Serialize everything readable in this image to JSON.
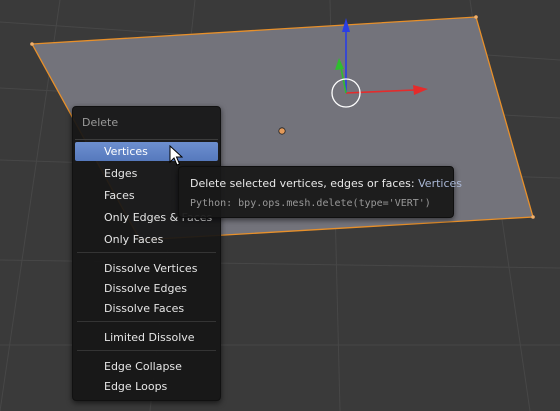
{
  "colors": {
    "background": "#3a3a3a",
    "grid": "#474747",
    "plane": "#73737b",
    "selection_outline": "#e8902a",
    "axis_x": "#e52b2b",
    "axis_y": "#2fbd2f",
    "axis_z": "#2a3ee6",
    "menu_highlight": "#5f82c6"
  },
  "menu": {
    "title": "Delete",
    "items": [
      {
        "label": "Vertices"
      },
      {
        "label": "Edges"
      },
      {
        "label": "Faces"
      },
      {
        "label": "Only Edges & Faces"
      },
      {
        "label": "Only Faces"
      },
      {
        "label": "Dissolve Vertices"
      },
      {
        "label": "Dissolve Edges"
      },
      {
        "label": "Dissolve Faces"
      },
      {
        "label": "Limited Dissolve"
      },
      {
        "label": "Edge Collapse"
      },
      {
        "label": "Edge Loops"
      }
    ]
  },
  "tooltip": {
    "text": "Delete selected vertices, edges or faces:",
    "highlight": "Vertices",
    "python": "Python: bpy.ops.mesh.delete(type='VERT')"
  }
}
